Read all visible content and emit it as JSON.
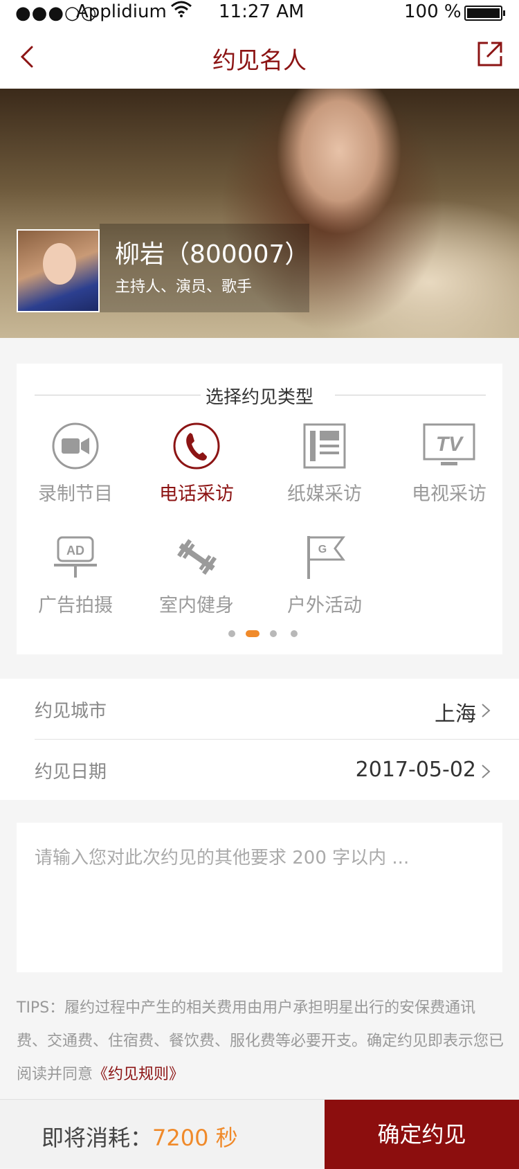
{
  "status_bar": {
    "signal": "●●●○○",
    "carrier": "Applidium",
    "time": "11:27 AM",
    "battery": "100 %"
  },
  "nav": {
    "title": "约见名人"
  },
  "celebrity": {
    "name": "柳岩（800007）",
    "roles": "主持人、演员、歌手"
  },
  "type_section": {
    "heading": "选择约见类型",
    "items": [
      {
        "label": "录制节目",
        "icon": "video-camera-icon",
        "selected": false
      },
      {
        "label": "电话采访",
        "icon": "phone-icon",
        "selected": true
      },
      {
        "label": "纸媒采访",
        "icon": "newspaper-icon",
        "selected": false
      },
      {
        "label": "电视采访",
        "icon": "tv-icon",
        "selected": false
      },
      {
        "label": "广告拍摄",
        "icon": "ad-board-icon",
        "selected": false
      },
      {
        "label": "室内健身",
        "icon": "dumbbell-icon",
        "selected": false
      },
      {
        "label": "户外活动",
        "icon": "flag-icon",
        "selected": false
      }
    ],
    "page_dots": {
      "count": 4,
      "active": 1
    }
  },
  "form": {
    "city": {
      "label": "约见城市",
      "value": "上海"
    },
    "date": {
      "label": "约见日期",
      "value": "2017-05-02"
    }
  },
  "note": {
    "placeholder": "请输入您对此次约见的其他要求 200 字以内 ..."
  },
  "tips": {
    "text": "TIPS：履约过程中产生的相关费用由用户承担明星出行的安保费通讯费、交通费、住宿费、餐饮费、服化费等必要开支。确定约见即表示您已阅读并同意",
    "link": "《约见规则》"
  },
  "bottom": {
    "cost_label": "即将消耗：",
    "cost_value": "7200 秒",
    "confirm": "确定约见"
  },
  "colors": {
    "brand": "#8c1414",
    "accent": "#f08a2a",
    "inactive_icon": "#9a9a9a"
  }
}
